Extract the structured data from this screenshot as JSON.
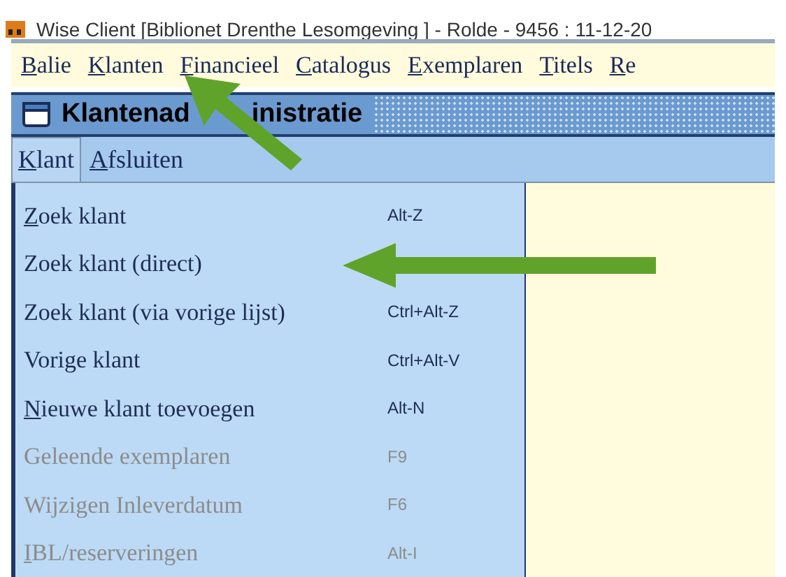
{
  "window": {
    "title": "Wise Client [Biblionet Drenthe Lesomgeving ] - Rolde - 9456 : 11-12-20"
  },
  "menu_bar": [
    {
      "label": "Balie",
      "underline_first": true
    },
    {
      "label": "Klanten",
      "underline_first": true
    },
    {
      "label": "Financieel",
      "underline_first": true
    },
    {
      "label": "Catalogus",
      "underline_first": true
    },
    {
      "label": "Exemplaren",
      "underline_first": true
    },
    {
      "label": "Titels",
      "underline_first": true
    },
    {
      "label": "Re",
      "underline_first": true
    }
  ],
  "panel": {
    "title_parts": [
      "Klantenad",
      "inistratie"
    ]
  },
  "sub_menu": [
    {
      "label": "Klant",
      "underline_first": true,
      "selected": true
    },
    {
      "label": "Afsluiten",
      "underline_first": true,
      "selected": false
    }
  ],
  "dropdown": [
    {
      "label": "Zoek klant",
      "shortcut": "Alt-Z",
      "underline_first": true,
      "disabled": false
    },
    {
      "label": "Zoek klant (direct)",
      "underline_first": false,
      "disabled": false
    },
    {
      "label": "Zoek klant (via vorige lijst)",
      "shortcut": "Ctrl+Alt-Z",
      "underline_first": false,
      "disabled": false
    },
    {
      "label": "Vorige klant",
      "shortcut": "Ctrl+Alt-V",
      "underline_first": false,
      "disabled": false
    },
    {
      "label": "Nieuwe klant toevoegen",
      "shortcut": "Alt-N",
      "underline_first": true,
      "disabled": false
    },
    {
      "label": "Geleende exemplaren",
      "shortcut": "F9",
      "underline_first": false,
      "disabled": true
    },
    {
      "label": "Wijzigen Inleverdatum",
      "shortcut": "F6",
      "underline_first": false,
      "disabled": true
    },
    {
      "label": "IBL/reserveringen",
      "shortcut": "Alt-I",
      "underline_first": true,
      "disabled": true
    }
  ]
}
